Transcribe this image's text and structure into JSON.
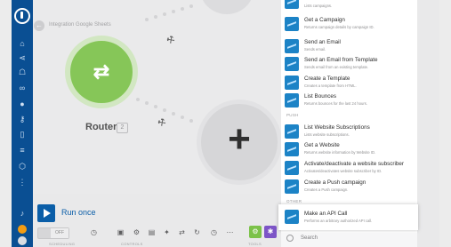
{
  "scenario": {
    "title": "Integration Google Sheets",
    "back_icon": "back-arrow-icon"
  },
  "router": {
    "label": "Router",
    "id": "2"
  },
  "toolbar": {
    "run_label": "Run once",
    "toggle_label": "OFF",
    "scheduling_label": "SCHEDULING",
    "controls_label": "CONTROLS",
    "tools_label": "TOOLS"
  },
  "panel": {
    "items_top": [
      {
        "title": "",
        "desc": "Lists campaigns."
      },
      {
        "title": "Get a Campaign",
        "desc": "Returns campaign details by campaign ID."
      },
      {
        "title": "Send an Email",
        "desc": "Sends email."
      },
      {
        "title": "Send an Email from Template",
        "desc": "Sends email from an existing template."
      },
      {
        "title": "Create a Template",
        "desc": "Creates a template from HTML."
      },
      {
        "title": "List Bounces",
        "desc": "Returns bounces for the last 24 hours."
      }
    ],
    "section_push": "PUSH",
    "items_push": [
      {
        "title": "List Website Subscriptions",
        "desc": "Lists website subscriptions."
      },
      {
        "title": "Get a Website",
        "desc": "Returns website information by Website ID."
      },
      {
        "title": "Activate/deactivate a website subscriber",
        "desc": "Activates/deactivates website subscriber by ID."
      },
      {
        "title": "Create a Push campaign",
        "desc": "Creates a Push campaign."
      }
    ],
    "section_other": "OTHER",
    "highlight": {
      "title": "Make an API Call",
      "desc": "Performs an arbitrary authorized API call."
    },
    "search_label": "Search"
  },
  "colors": {
    "sidebar": "#0a4f93",
    "router_green": "#7cc24a",
    "panel_icon": "#1c83c6",
    "run_blue": "#0b5ea8",
    "tools_purple": "#7d55c7"
  }
}
